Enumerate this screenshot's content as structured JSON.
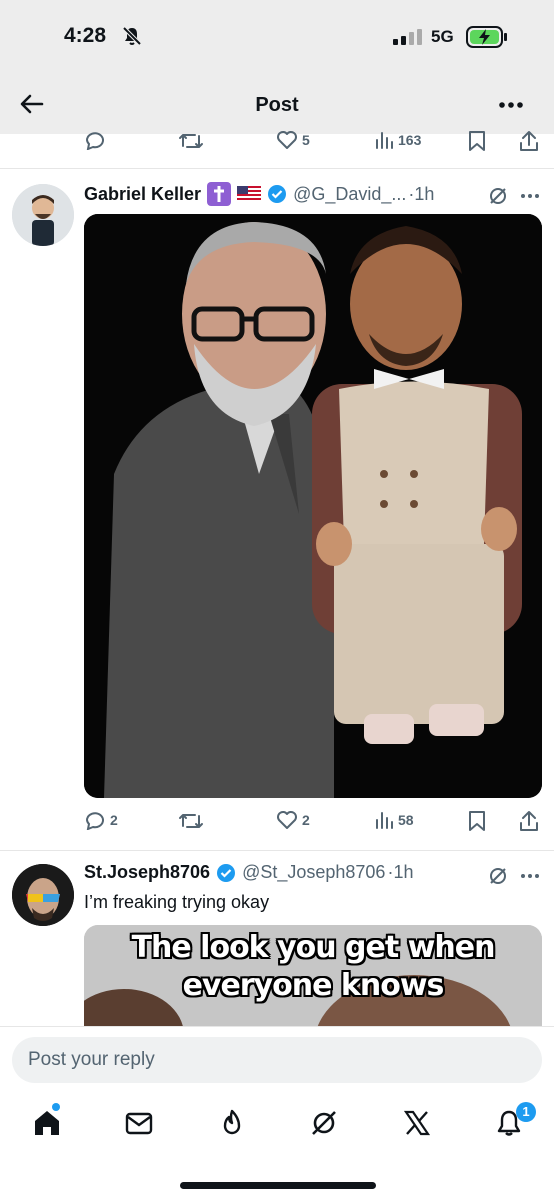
{
  "status_bar": {
    "time": "4:28",
    "network": "5G"
  },
  "header": {
    "title": "Post"
  },
  "prev_actions": {
    "reply": "",
    "repost": "",
    "likes": "5",
    "views": "163"
  },
  "tweet1": {
    "name": "Gabriel Keller",
    "handle": "@G_David_...",
    "time": "·1h",
    "actions": {
      "reply": "2",
      "repost": "",
      "likes": "2",
      "views": "58"
    }
  },
  "tweet2": {
    "name": "St.Joseph8706",
    "handle": "@St_Joseph8706",
    "time": "·1h",
    "text": "I’m freaking trying okay",
    "meme_line1": "The look you get when",
    "meme_line2": "everyone knows"
  },
  "reply": {
    "placeholder": "Post your reply"
  },
  "tabbar": {
    "icons": [
      "home-icon",
      "mail-icon",
      "flame-icon",
      "grok-icon",
      "x-icon",
      "notifications-icon"
    ],
    "notification_count": "1"
  },
  "colors": {
    "accent": "#1d9bf0",
    "muted": "#536471",
    "header_bg": "#ededed"
  }
}
